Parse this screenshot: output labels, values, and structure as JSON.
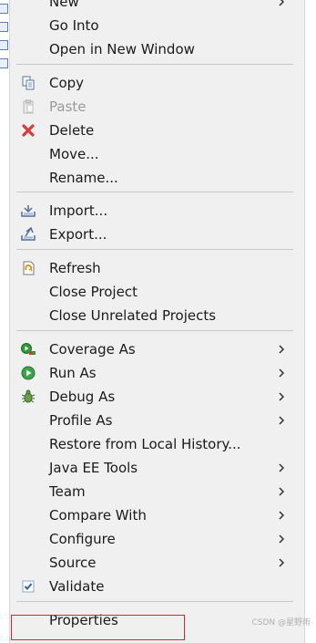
{
  "menu": {
    "items": [
      {
        "label": "New"
      },
      {
        "label": "Go Into"
      },
      {
        "label": "Open in New Window"
      },
      {
        "label": "Copy"
      },
      {
        "label": "Paste"
      },
      {
        "label": "Delete"
      },
      {
        "label": "Move..."
      },
      {
        "label": "Rename..."
      },
      {
        "label": "Import..."
      },
      {
        "label": "Export..."
      },
      {
        "label": "Refresh"
      },
      {
        "label": "Close Project"
      },
      {
        "label": "Close Unrelated Projects"
      },
      {
        "label": "Coverage As"
      },
      {
        "label": "Run As"
      },
      {
        "label": "Debug As"
      },
      {
        "label": "Profile As"
      },
      {
        "label": "Restore from Local History..."
      },
      {
        "label": "Java EE Tools"
      },
      {
        "label": "Team"
      },
      {
        "label": "Compare With"
      },
      {
        "label": "Configure"
      },
      {
        "label": "Source"
      },
      {
        "label": "Validate"
      },
      {
        "label": "Properties"
      }
    ]
  },
  "watermark": "CSDN @星野雨"
}
